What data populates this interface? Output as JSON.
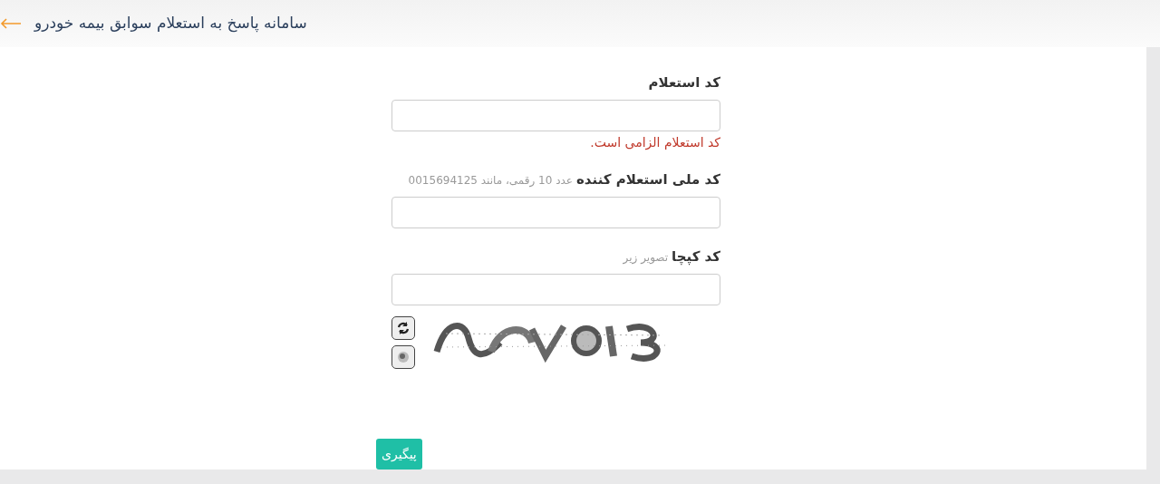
{
  "header": {
    "title": "سامانه پاسخ به استعلام سوابق بیمه خودرو"
  },
  "fields": [
    {
      "label": "کد استعلام",
      "error": "کد استعلام الزامی است."
    },
    {
      "label": "کد ملی استعلام کننده",
      "hint": "عدد 10 رقمی، مانند 0015694125"
    },
    {
      "label": "کد کپچا",
      "hint": "تصویر زیر"
    }
  ],
  "submit": {
    "label": "پیگیری"
  }
}
